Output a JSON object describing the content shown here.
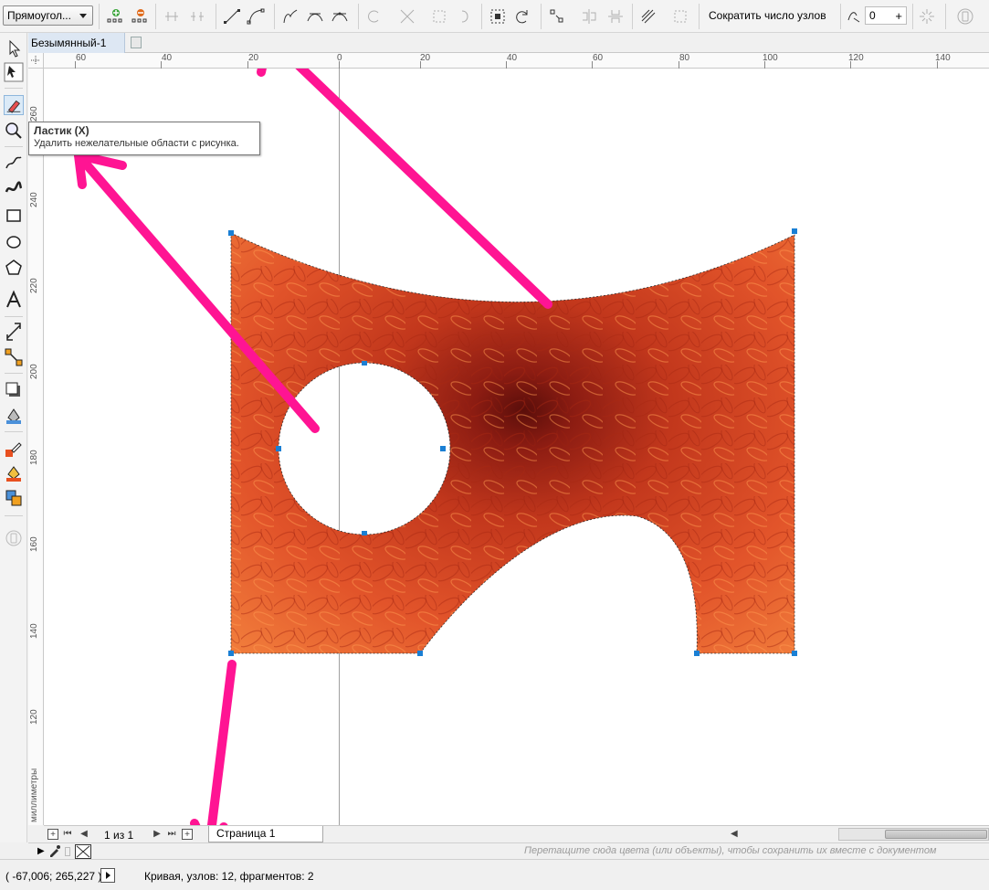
{
  "toolbar": {
    "mode_select": "Прямоугол...",
    "reduce_nodes_label": "Сократить число узлов",
    "smoothness_value": "0"
  },
  "document": {
    "tab_title": "Безымянный-1"
  },
  "ruler": {
    "units": "миллиметры",
    "h_labels": [
      "60",
      "40",
      "20",
      "0",
      "20",
      "40",
      "60",
      "80",
      "100",
      "120",
      "140"
    ],
    "v_labels": [
      "260",
      "240",
      "220",
      "200",
      "180",
      "160",
      "140",
      "120"
    ]
  },
  "tooltip": {
    "title": "Ластик (X)",
    "description": "Удалить нежелательные области с рисунка."
  },
  "page_nav": {
    "page_count": "1 из 1",
    "page_tab": "Страница 1"
  },
  "palette": {
    "hint": "Перетащите сюда цвета (или объекты), чтобы сохранить их вместе с документом"
  },
  "status": {
    "coordinates": "( -67,006; 265,227 )",
    "object_info": "Кривая, узлов: 12, фрагментов: 2"
  },
  "colors": {
    "annotation_arrow": "#ff1493",
    "petal_dark": "#b8321a",
    "petal_light": "#f26a2c",
    "node_handle": "#1a7fd4"
  }
}
